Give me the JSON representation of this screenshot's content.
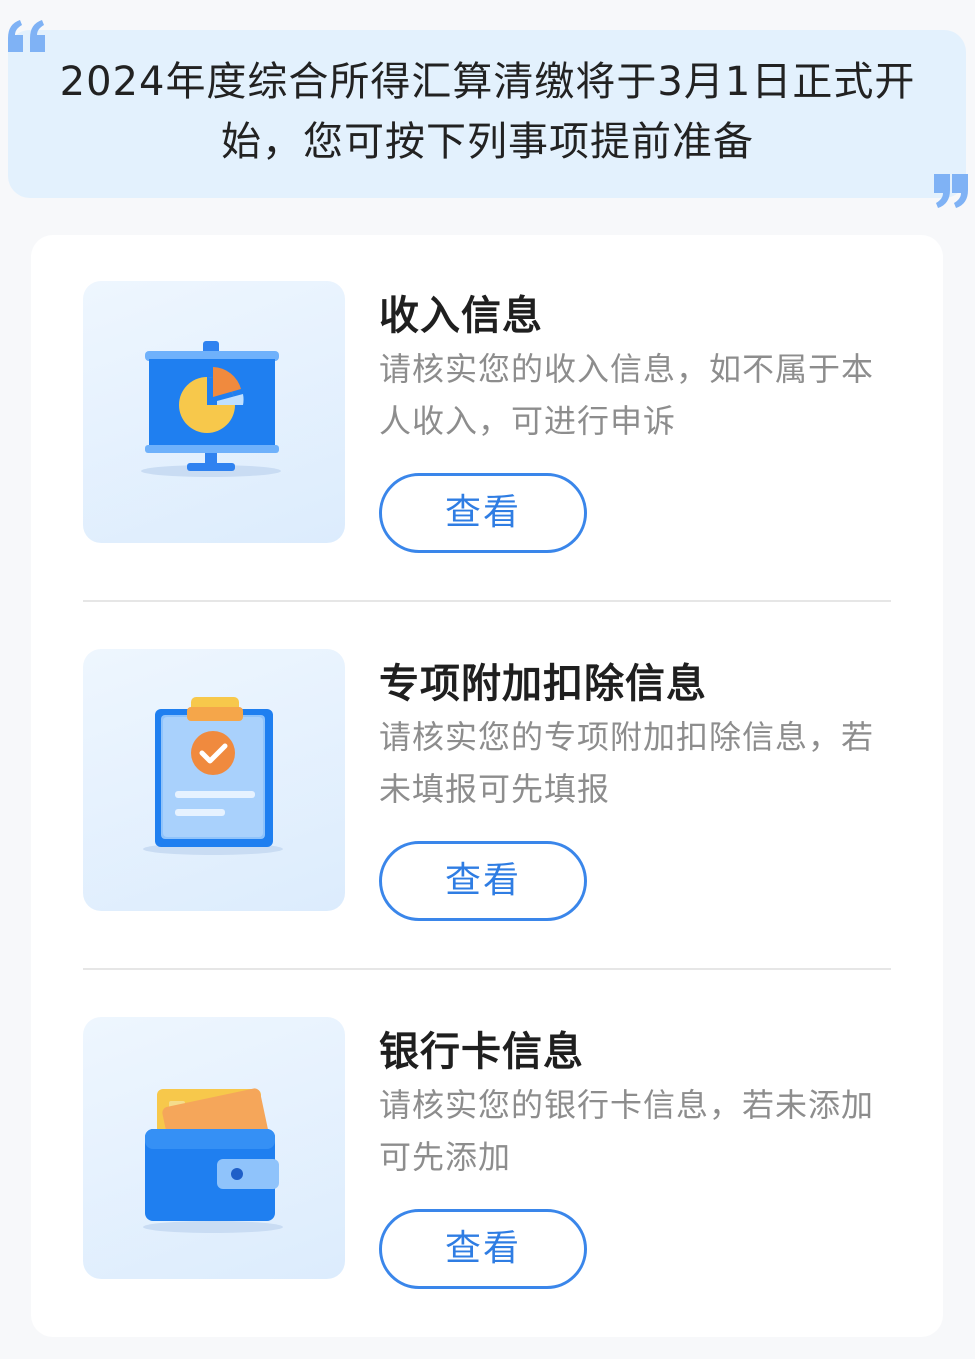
{
  "banner": {
    "line1": "2024年度综合所得汇算清缴将于3月1日正式开",
    "line2": "始，您可按下列事项提前准备"
  },
  "items": [
    {
      "title": "收入信息",
      "desc": "请核实您的收入信息，如不属于本人收入，可进行申诉",
      "button": "查看",
      "icon": "presentation-chart-icon"
    },
    {
      "title": "专项附加扣除信息",
      "desc": "请核实您的专项附加扣除信息，若未填报可先填报",
      "button": "查看",
      "icon": "clipboard-check-icon"
    },
    {
      "title": "银行卡信息",
      "desc": "请核实您的银行卡信息，若未添加可先添加",
      "button": "查看",
      "icon": "wallet-card-icon"
    }
  ],
  "colors": {
    "accent": "#3a86ea",
    "banner_bg": "#e3f1fd",
    "quote": "#7fb2f5"
  }
}
